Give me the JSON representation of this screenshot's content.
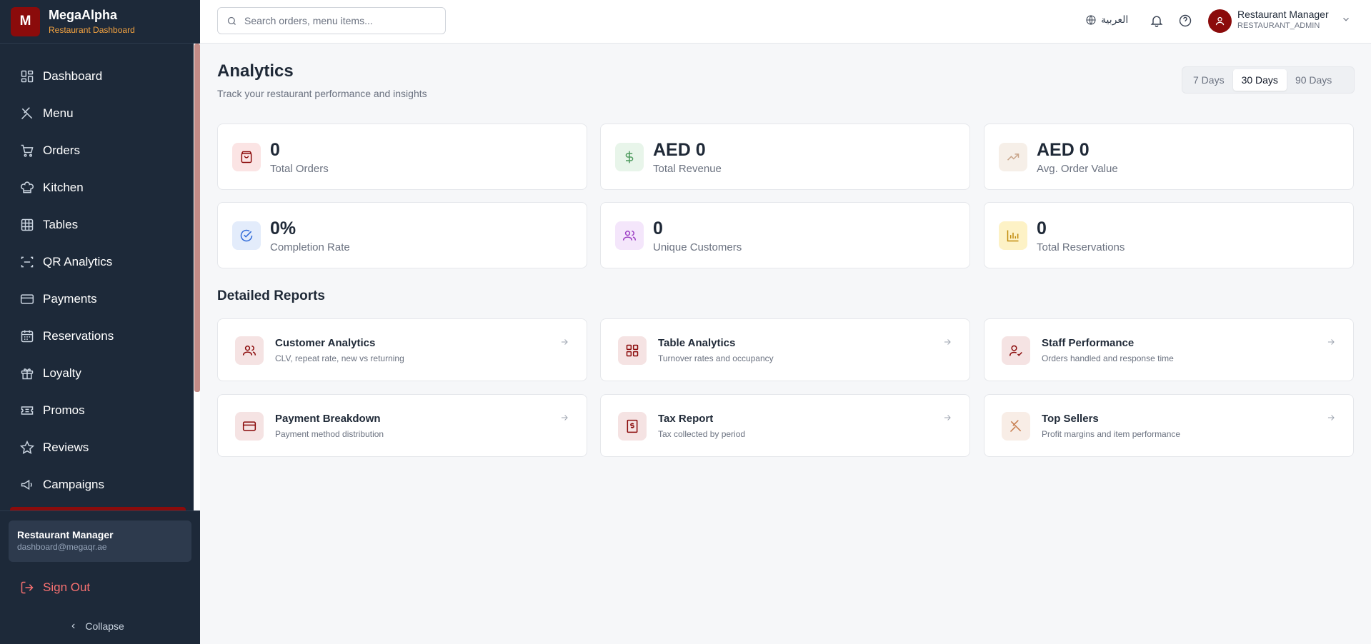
{
  "brand": {
    "logo_letter": "M",
    "name": "MegaAlpha",
    "subtitle": "Restaurant Dashboard"
  },
  "sidebar": {
    "items": [
      {
        "label": "Dashboard",
        "icon": "grid-icon"
      },
      {
        "label": "Menu",
        "icon": "utensils-icon"
      },
      {
        "label": "Orders",
        "icon": "cart-icon"
      },
      {
        "label": "Kitchen",
        "icon": "chef-hat-icon"
      },
      {
        "label": "Tables",
        "icon": "table-icon"
      },
      {
        "label": "QR Analytics",
        "icon": "qr-scan-icon"
      },
      {
        "label": "Payments",
        "icon": "credit-card-icon"
      },
      {
        "label": "Reservations",
        "icon": "calendar-icon"
      },
      {
        "label": "Loyalty",
        "icon": "gift-icon"
      },
      {
        "label": "Promos",
        "icon": "ticket-icon"
      },
      {
        "label": "Reviews",
        "icon": "star-icon"
      },
      {
        "label": "Campaigns",
        "icon": "megaphone-icon"
      }
    ],
    "user_card": {
      "name": "Restaurant Manager",
      "email": "dashboard@megaqr.ae"
    },
    "signout_label": "Sign Out",
    "collapse_label": "Collapse"
  },
  "topbar": {
    "search_placeholder": "Search orders, menu items...",
    "language_label": "العربية",
    "user_name": "Restaurant Manager",
    "user_role": "RESTAURANT_ADMIN"
  },
  "page": {
    "title": "Analytics",
    "subtitle": "Track your restaurant performance and insights",
    "ranges": [
      "7 Days",
      "30 Days",
      "90 Days"
    ],
    "active_range": "30 Days"
  },
  "stats": [
    {
      "value": "0",
      "label": "Total Orders",
      "icon": "shopping-bag-icon",
      "bg": "#fbe4e4",
      "color": "#8b0b0b"
    },
    {
      "value": "AED 0",
      "label": "Total Revenue",
      "icon": "dollar-icon",
      "bg": "#e8f5ea",
      "color": "#4c9a5c"
    },
    {
      "value": "AED 0",
      "label": "Avg. Order Value",
      "icon": "trending-up-icon",
      "bg": "#f6efe8",
      "color": "#c9a58a"
    },
    {
      "value": "0%",
      "label": "Completion Rate",
      "icon": "check-circle-icon",
      "bg": "#e3ecfb",
      "color": "#2f6ad9"
    },
    {
      "value": "0",
      "label": "Unique Customers",
      "icon": "users-icon",
      "bg": "#f4e6fb",
      "color": "#9c3fc4"
    },
    {
      "value": "0",
      "label": "Total Reservations",
      "icon": "bar-chart-icon",
      "bg": "#fdf2c6",
      "color": "#c08a0a"
    }
  ],
  "reports_title": "Detailed Reports",
  "reports": [
    {
      "title": "Customer Analytics",
      "desc": "CLV, repeat rate, new vs returning",
      "icon": "users-icon",
      "bg": "#f5e3e3",
      "color": "#8b0b0b"
    },
    {
      "title": "Table Analytics",
      "desc": "Turnover rates and occupancy",
      "icon": "grid-icon",
      "bg": "#f5e3e3",
      "color": "#8b0b0b"
    },
    {
      "title": "Staff Performance",
      "desc": "Orders handled and response time",
      "icon": "user-check-icon",
      "bg": "#f5e3e3",
      "color": "#8b0b0b"
    },
    {
      "title": "Payment Breakdown",
      "desc": "Payment method distribution",
      "icon": "credit-card-icon",
      "bg": "#f5e3e3",
      "color": "#8b0b0b"
    },
    {
      "title": "Tax Report",
      "desc": "Tax collected by period",
      "icon": "receipt-icon",
      "bg": "#f5e3e3",
      "color": "#8b0b0b"
    },
    {
      "title": "Top Sellers",
      "desc": "Profit margins and item performance",
      "icon": "utensils-icon",
      "bg": "#f8ede6",
      "color": "#c77d4e"
    }
  ]
}
